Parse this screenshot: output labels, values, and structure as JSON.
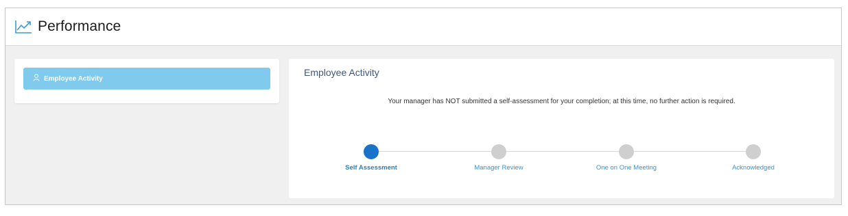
{
  "header": {
    "title": "Performance",
    "icon": "trend-chart-icon",
    "icon_color": "#3a9ad9"
  },
  "sidebar": {
    "items": [
      {
        "label": "Employee Activity",
        "icon": "user-icon",
        "active": true,
        "bg_color": "#7fcaed"
      }
    ]
  },
  "main": {
    "section_title": "Employee Activity",
    "message": "Your manager has NOT submitted a self-assessment for your completion; at this time, no further action is required.",
    "steps": [
      {
        "label": "Self Assessment",
        "active": true
      },
      {
        "label": "Manager Review",
        "active": false
      },
      {
        "label": "One on One Meeting",
        "active": false
      },
      {
        "label": "Acknowledged",
        "active": false
      }
    ],
    "active_color": "#1a73c9",
    "inactive_color": "#cfcfcf"
  }
}
